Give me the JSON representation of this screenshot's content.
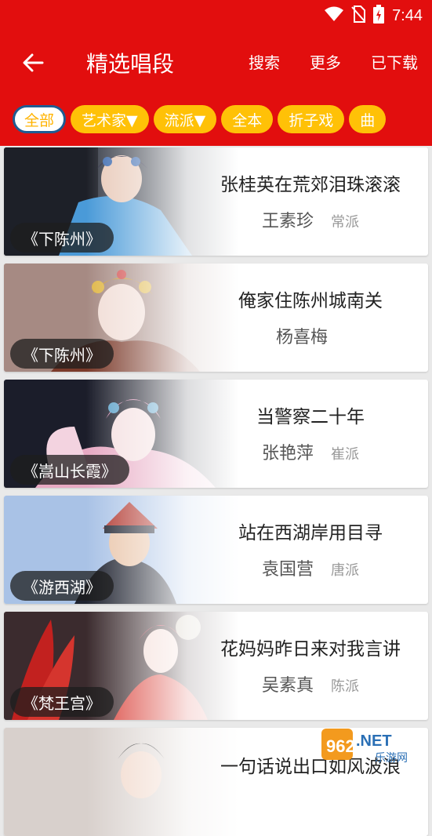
{
  "status_bar": {
    "time": "7:44",
    "icons": [
      "wifi-icon",
      "no-sim-icon",
      "battery-charging-icon"
    ]
  },
  "header": {
    "title": "精选唱段",
    "actions": [
      "搜索",
      "更多",
      "已下载"
    ]
  },
  "filters": {
    "items": [
      {
        "label": "全部",
        "active": true
      },
      {
        "label": "艺术家▼",
        "active": false
      },
      {
        "label": "流派▼",
        "active": false
      },
      {
        "label": "全本",
        "active": false
      },
      {
        "label": "折子戏",
        "active": false
      },
      {
        "label": "曲",
        "active": false
      }
    ]
  },
  "songs": [
    {
      "opera": "《下陈州》",
      "title": "张桂英在荒郊泪珠滚滚",
      "artist": "王素珍",
      "school": "常派"
    },
    {
      "opera": "《下陈州》",
      "title": "俺家住陈州城南关",
      "artist": "杨喜梅",
      "school": ""
    },
    {
      "opera": "《嵩山长霞》",
      "title": "当警察二十年",
      "artist": "张艳萍",
      "school": "崔派"
    },
    {
      "opera": "《游西湖》",
      "title": "站在西湖岸用目寻",
      "artist": "袁国营",
      "school": "唐派"
    },
    {
      "opera": "《梵王宫》",
      "title": "花妈妈昨日来对我言讲",
      "artist": "吴素真",
      "school": "陈派"
    },
    {
      "opera": "",
      "title": "一句话说出口如风波浪",
      "artist": "",
      "school": ""
    }
  ],
  "watermark": {
    "line1": "962",
    "line2": ".NET",
    "line3": "乐游网"
  }
}
